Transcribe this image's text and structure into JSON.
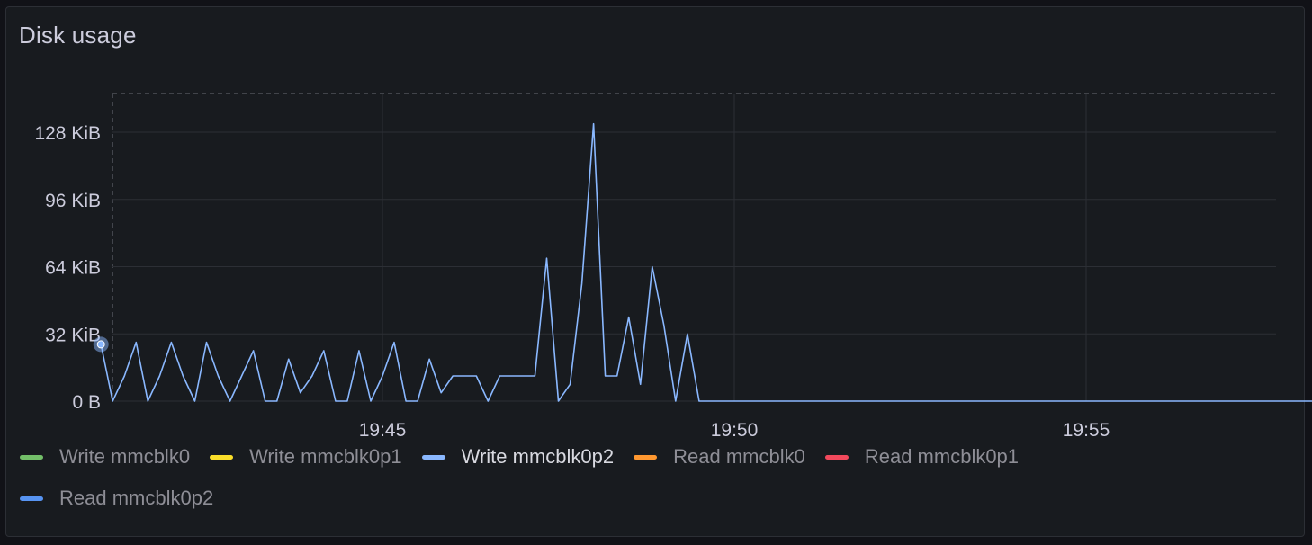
{
  "panel": {
    "title": "Disk usage"
  },
  "chart_data": {
    "type": "line",
    "title": "Disk usage",
    "xlabel": "",
    "ylabel": "",
    "x_ticks": [
      "19:45",
      "19:50",
      "19:55"
    ],
    "y_ticks": [
      "0 B",
      "32 KiB",
      "64 KiB",
      "96 KiB",
      "128 KiB"
    ],
    "ylim": [
      0,
      146
    ],
    "grid": true,
    "legend_position": "bottom",
    "series": [
      {
        "name": "Write mmcblk0",
        "color": "#73bf69",
        "active": false,
        "values": []
      },
      {
        "name": "Write mmcblk0p1",
        "color": "#fade2a",
        "active": false,
        "values": []
      },
      {
        "name": "Write mmcblk0p2",
        "color": "#8ab8ff",
        "active": true,
        "x": [
          "19:41:00",
          "19:41:10",
          "19:41:20",
          "19:41:30",
          "19:41:40",
          "19:41:50",
          "19:42:00",
          "19:42:10",
          "19:42:20",
          "19:42:30",
          "19:42:40",
          "19:42:50",
          "19:43:00",
          "19:43:10",
          "19:43:20",
          "19:43:30",
          "19:43:40",
          "19:43:50",
          "19:44:00",
          "19:44:10",
          "19:44:20",
          "19:44:30",
          "19:44:40",
          "19:44:50",
          "19:45:00",
          "19:45:10",
          "19:45:20",
          "19:45:30",
          "19:45:40",
          "19:45:50",
          "19:46:00",
          "19:46:10",
          "19:46:20",
          "19:46:30",
          "19:46:40",
          "19:46:50",
          "19:47:00",
          "19:47:10",
          "19:47:20",
          "19:47:30",
          "19:47:40",
          "19:47:50",
          "19:48:00",
          "19:48:10",
          "19:48:20",
          "19:48:30",
          "19:48:40",
          "19:48:50",
          "19:49:00",
          "19:49:10",
          "19:49:20",
          "19:49:30",
          "19:49:40",
          "19:49:50",
          "19:50:00",
          "19:50:10",
          "19:58:20"
        ],
        "values": [
          27,
          0,
          12,
          28,
          0,
          12,
          28,
          12,
          0,
          28,
          12,
          0,
          12,
          24,
          0,
          0,
          20,
          4,
          12,
          24,
          0,
          0,
          24,
          0,
          12,
          28,
          0,
          0,
          20,
          4,
          12,
          12,
          12,
          0,
          12,
          12,
          12,
          12,
          68,
          0,
          8,
          56,
          132,
          12,
          12,
          40,
          8,
          64,
          36,
          0,
          32,
          0,
          0,
          0,
          0,
          0,
          0
        ]
      },
      {
        "name": "Read mmcblk0",
        "color": "#ff9830",
        "active": false,
        "values": []
      },
      {
        "name": "Read mmcblk0p1",
        "color": "#f2495c",
        "active": false,
        "values": []
      },
      {
        "name": "Read mmcblk0p2",
        "color": "#5794f2",
        "active": false,
        "values": []
      }
    ]
  }
}
